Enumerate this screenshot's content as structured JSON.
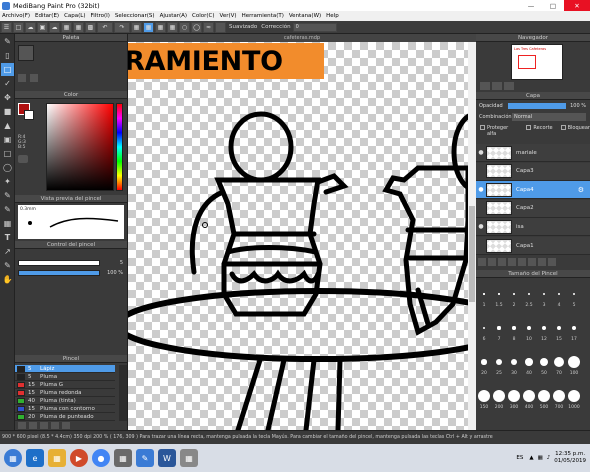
{
  "window": {
    "title": "MediBang Paint Pro (32bit)"
  },
  "menu": [
    "Archivo(F)",
    "Editar(E)",
    "Capa(L)",
    "Filtro(I)",
    "Seleccionar(S)",
    "Ajustar(A)",
    "Color(C)",
    "Ver(V)",
    "Herramienta(T)",
    "Ventana(W)",
    "Help"
  ],
  "toolbar": {
    "suavizado_label": "Suavizado",
    "correccion_label": "Corrección",
    "correccion_value": "0"
  },
  "panels": {
    "paleta": "Paleta",
    "color": "Color",
    "color_values": [
      "R:4",
      "G:3",
      "B:5"
    ],
    "vista_previa": "Vista previa del pincel",
    "brush_size": "0.3mm",
    "control_pincel": "Control del pincel",
    "control_size_value": "5",
    "control_opacity_value": "100 %",
    "pincel": "Pincel",
    "navegador": "Navegador",
    "capa": "Capa",
    "opacidad_label": "Opacidad",
    "opacidad_value": "100 %",
    "combinacion_label": "Combinación",
    "combinacion_value": "Normal",
    "proteger_alfa": "Proteger alfa",
    "recorte": "Recorte",
    "bloquear": "Bloquear",
    "tamano_pincel": "Tamaño del Pincel"
  },
  "document": {
    "tab_title": "cafeteras.mdp",
    "banner_text": "MEJORAMIENTO",
    "nav_thumb_text": "Las Tres Cafeteras"
  },
  "layers": [
    {
      "name": "mariale",
      "visible": true,
      "selected": false
    },
    {
      "name": "Capa3",
      "visible": false,
      "selected": false
    },
    {
      "name": "Capa4",
      "visible": true,
      "selected": true
    },
    {
      "name": "Capa2",
      "visible": false,
      "selected": false
    },
    {
      "name": "isa",
      "visible": true,
      "selected": false
    },
    {
      "name": "Capa1",
      "visible": false,
      "selected": false
    }
  ],
  "brushes": [
    {
      "name": "Lápiz",
      "value": "5",
      "color": "#222222",
      "selected": true
    },
    {
      "name": "Pluma",
      "value": "5",
      "color": "#222222",
      "selected": false
    },
    {
      "name": "Pluma G",
      "value": "15",
      "color": "#e03030",
      "selected": false
    },
    {
      "name": "Pluma redonda",
      "value": "15",
      "color": "#e03030",
      "selected": false
    },
    {
      "name": "Pluma (tinta)",
      "value": "40",
      "color": "#30b030",
      "selected": false
    },
    {
      "name": "Pluma con contorno",
      "value": "15",
      "color": "#3050d0",
      "selected": false
    },
    {
      "name": "Pluma de punteado",
      "value": "20",
      "color": "#30b030",
      "selected": false
    }
  ],
  "brush_sizes": [
    "1",
    "1.5",
    "2",
    "2.5",
    "3",
    "4",
    "5",
    "6",
    "7",
    "8",
    "10",
    "12",
    "15",
    "17",
    "20",
    "25",
    "30",
    "40",
    "50",
    "70",
    "100",
    "150",
    "200",
    "300",
    "400",
    "500",
    "700",
    "1000"
  ],
  "status": {
    "text": "900 * 600 pixel  (8.5 * 4.4cm)  350 dpi  200 %  ( 176, 309 )   Para trazar una línea recta, mantenga pulsada la tecla Mayús. Para cambiar el tamaño del pincel, mantenga pulsada las teclas Ctrl + Alt y arrastre"
  },
  "taskbar": {
    "lang": "ES",
    "time": "12:35 p.m.",
    "date": "01/05/2019"
  },
  "colors": {
    "accent": "#4f9be8",
    "banner": "#f28c2c",
    "fg_color": "#b01010"
  }
}
